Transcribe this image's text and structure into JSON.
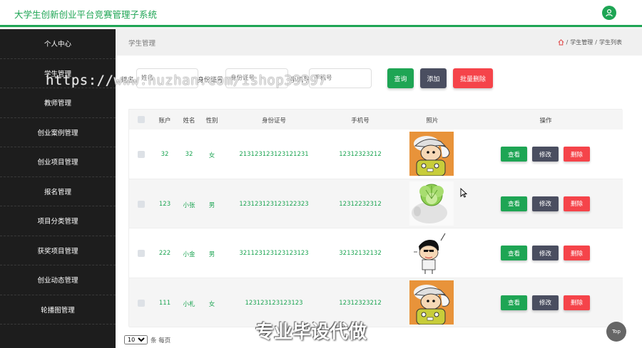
{
  "header": {
    "title": "大学生创新创业平台竞赛管理子系统"
  },
  "sidebar": {
    "items": [
      {
        "label": "个人中心"
      },
      {
        "label": "学生管理"
      },
      {
        "label": "教师管理"
      },
      {
        "label": "创业案例管理"
      },
      {
        "label": "创业项目管理"
      },
      {
        "label": "报名管理"
      },
      {
        "label": "项目分类管理"
      },
      {
        "label": "获奖项目管理"
      },
      {
        "label": "创业动态管理"
      },
      {
        "label": "轮播图管理"
      }
    ]
  },
  "page": {
    "title": "学生管理",
    "breadcrumb": [
      "学生管理",
      "学生列表"
    ],
    "breadcrumb_sep": "/"
  },
  "search": {
    "name_label": "姓名",
    "name_placeholder": "姓名",
    "idcard_label": "身份证号",
    "idcard_placeholder": "身份证号",
    "phone_label": "手机号",
    "phone_placeholder": "手机号",
    "query_label": "查询",
    "add_label": "添加",
    "batch_delete_label": "批量删除"
  },
  "table": {
    "columns": [
      "账户",
      "姓名",
      "性别",
      "身份证号",
      "手机号",
      "照片",
      "操作"
    ],
    "rows": [
      {
        "account": "32",
        "name": "32",
        "gender": "女",
        "idcard": "213123123123121231",
        "phone": "12312323212",
        "photo": "cartoon-boy-icon"
      },
      {
        "account": "123",
        "name": "小张",
        "gender": "男",
        "idcard": "123123123123122323",
        "phone": "12312232312",
        "photo": "cabbage-dog-icon"
      },
      {
        "account": "222",
        "name": "小金",
        "gender": "男",
        "idcard": "321123123123123123",
        "phone": "32132132132",
        "photo": "cartoon-boy-icon"
      },
      {
        "account": "111",
        "name": "小札",
        "gender": "女",
        "idcard": "123123123123123",
        "phone": "12312323212",
        "photo": "cartoon-boy-icon"
      }
    ],
    "actions": {
      "view": "查看",
      "edit": "修改",
      "delete": "删除"
    }
  },
  "pagination": {
    "page_size": "10",
    "unit": "条 每页"
  },
  "overlay": {
    "watermark": "https://www.huzhan.com/ishop39397",
    "banner": "专业毕设代做",
    "to_top": "Top"
  },
  "colors": {
    "primary": "#1ea554",
    "dark": "#1d1d1d",
    "secondary": "#4a4e60",
    "danger": "#f5444a"
  }
}
